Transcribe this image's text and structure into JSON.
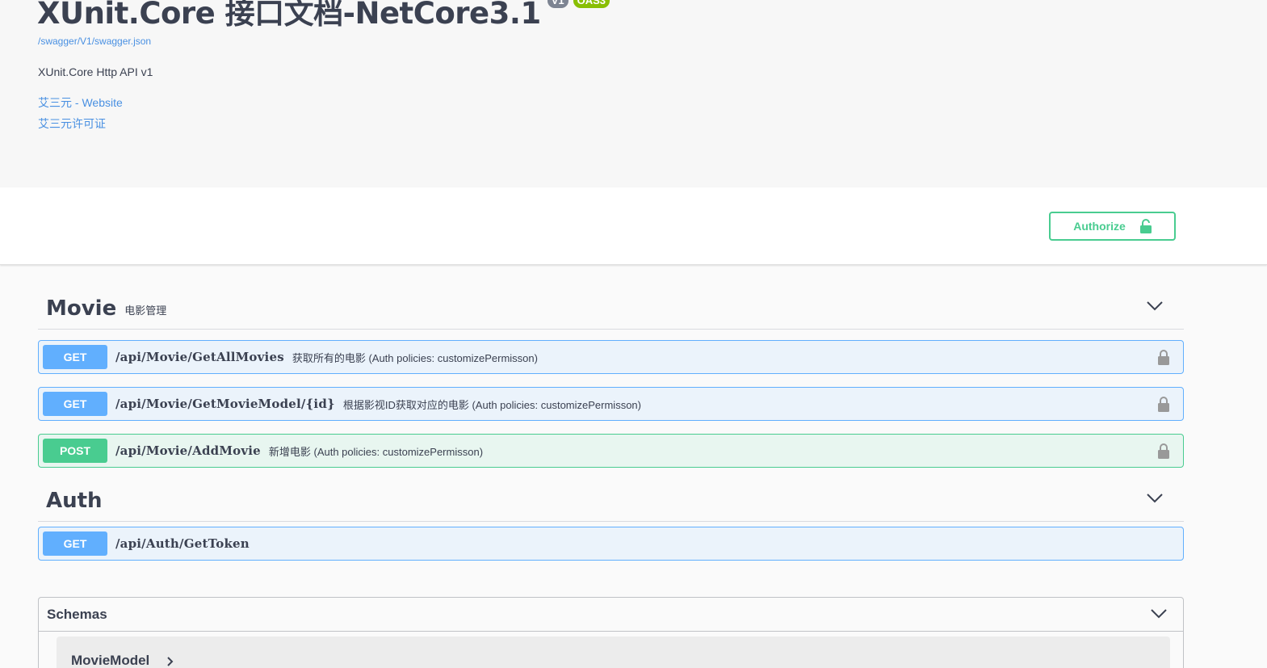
{
  "info": {
    "title": "XUnit.Core 接口文档-NetCore3.1",
    "version_badge": "V1",
    "oas_badge": "OAS3",
    "spec_url": "/swagger/V1/swagger.json",
    "description": "XUnit.Core Http API v1",
    "contact_link": "艾三元 - Website",
    "license_link": "艾三元许可证"
  },
  "scheme": {
    "authorize_label": "Authorize"
  },
  "tags": [
    {
      "name": "Movie",
      "description": "电影管理",
      "operations": [
        {
          "method": "GET",
          "path": "/api/Movie/GetAllMovies",
          "summary": "获取所有的电影 (Auth policies: customizePermisson)"
        },
        {
          "method": "GET",
          "path": "/api/Movie/GetMovieModel/{id}",
          "summary": "根据影视ID获取对应的电影 (Auth policies: customizePermisson)"
        },
        {
          "method": "POST",
          "path": "/api/Movie/AddMovie",
          "summary": "新增电影 (Auth policies: customizePermisson)"
        }
      ]
    },
    {
      "name": "Auth",
      "description": "",
      "operations": [
        {
          "method": "GET",
          "path": "/api/Auth/GetToken",
          "summary": ""
        }
      ]
    }
  ],
  "schemas": {
    "title": "Schemas",
    "models": [
      "MovieModel"
    ]
  },
  "colors": {
    "get": "#61affe",
    "post": "#49cc90",
    "link": "#4990e2",
    "text": "#3b4151"
  },
  "icons": {
    "lock": "lock-icon",
    "chevron": "chevron-down-icon",
    "model_expand": "chevron-right-icon"
  }
}
